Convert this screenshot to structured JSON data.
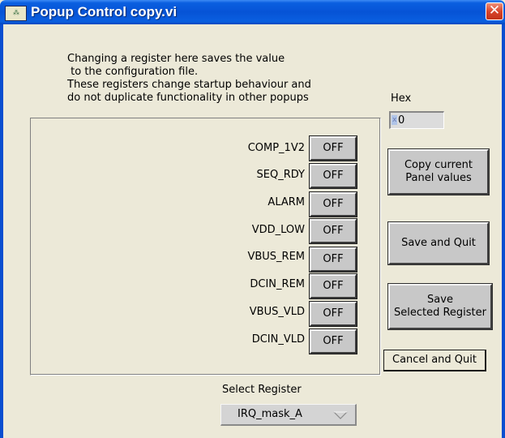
{
  "window": {
    "title": "Popup Control copy.vi",
    "close_glyph": "✕",
    "app_icon_glyph": "⁂",
    "icons": [
      "app-icon",
      "close-icon",
      "dropdown-arrow-icon"
    ],
    "colors": {
      "titlebar": "#0653d6",
      "close": "#d8452c",
      "background": "#ece9d8"
    }
  },
  "instructions": {
    "lines": [
      "Changing a register here saves the value",
      " to the configuration file.",
      "These registers change startup behaviour and",
      "do not duplicate functionality in other popups"
    ]
  },
  "hex": {
    "label": "Hex",
    "radix": "x",
    "value": "0"
  },
  "registers": [
    {
      "label": "COMP_1V2",
      "state": "OFF"
    },
    {
      "label": "SEQ_RDY",
      "state": "OFF"
    },
    {
      "label": "ALARM",
      "state": "OFF"
    },
    {
      "label": "VDD_LOW",
      "state": "OFF"
    },
    {
      "label": "VBUS_REM",
      "state": "OFF"
    },
    {
      "label": "DCIN_REM",
      "state": "OFF"
    },
    {
      "label": "VBUS_VLD",
      "state": "OFF"
    },
    {
      "label": "DCIN_VLD",
      "state": "OFF"
    }
  ],
  "buttons": {
    "copy_line1": "Copy current",
    "copy_line2": "Panel values",
    "save_quit": "Save and Quit",
    "save_selected_line1": "Save",
    "save_selected_line2": "Selected Register",
    "cancel_quit": "Cancel and Quit"
  },
  "select": {
    "label": "Select Register",
    "value": "IRQ_mask_A"
  }
}
